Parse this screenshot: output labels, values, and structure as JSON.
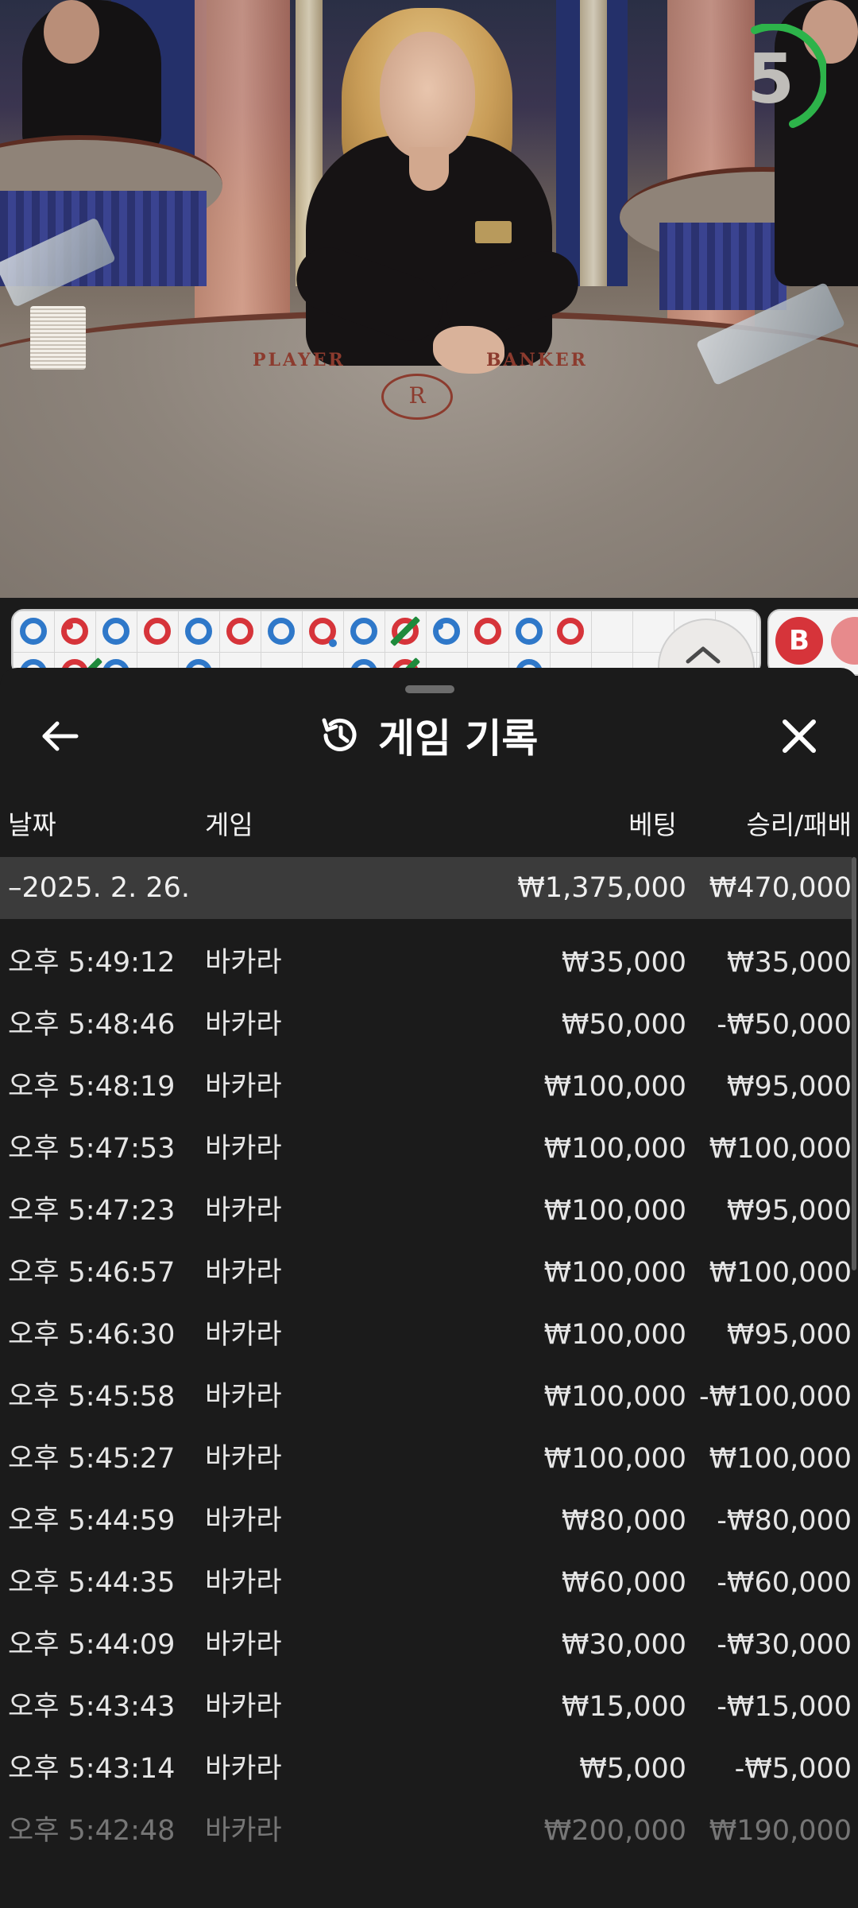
{
  "stream": {
    "countdown": "5",
    "felt_left": "PLAYER",
    "felt_right": "BANKER",
    "felt_logo": "R"
  },
  "roads": {
    "side_label": "B",
    "colors": {
      "player": "#2f78c9",
      "banker": "#d6343a",
      "tie": "#1f8a3c"
    }
  },
  "sheet": {
    "title": "게임 기록",
    "back_icon": "arrow-left-icon",
    "history_icon": "history-icon",
    "close_icon": "close-icon",
    "columns": {
      "date": "날짜",
      "game": "게임",
      "bet": "베팅",
      "win_loss": "승리/패배"
    },
    "summary": {
      "date": "–2025. 2. 26.",
      "bet": "₩1,375,000",
      "win_loss": "₩470,000"
    },
    "rows": [
      {
        "time": "오후 5:49:12",
        "game": "바카라",
        "bet": "₩35,000",
        "win_loss": "₩35,000"
      },
      {
        "time": "오후 5:48:46",
        "game": "바카라",
        "bet": "₩50,000",
        "win_loss": "-₩50,000"
      },
      {
        "time": "오후 5:48:19",
        "game": "바카라",
        "bet": "₩100,000",
        "win_loss": "₩95,000"
      },
      {
        "time": "오후 5:47:53",
        "game": "바카라",
        "bet": "₩100,000",
        "win_loss": "₩100,000"
      },
      {
        "time": "오후 5:47:23",
        "game": "바카라",
        "bet": "₩100,000",
        "win_loss": "₩95,000"
      },
      {
        "time": "오후 5:46:57",
        "game": "바카라",
        "bet": "₩100,000",
        "win_loss": "₩100,000"
      },
      {
        "time": "오후 5:46:30",
        "game": "바카라",
        "bet": "₩100,000",
        "win_loss": "₩95,000"
      },
      {
        "time": "오후 5:45:58",
        "game": "바카라",
        "bet": "₩100,000",
        "win_loss": "-₩100,000"
      },
      {
        "time": "오후 5:45:27",
        "game": "바카라",
        "bet": "₩100,000",
        "win_loss": "₩100,000"
      },
      {
        "time": "오후 5:44:59",
        "game": "바카라",
        "bet": "₩80,000",
        "win_loss": "-₩80,000"
      },
      {
        "time": "오후 5:44:35",
        "game": "바카라",
        "bet": "₩60,000",
        "win_loss": "-₩60,000"
      },
      {
        "time": "오후 5:44:09",
        "game": "바카라",
        "bet": "₩30,000",
        "win_loss": "-₩30,000"
      },
      {
        "time": "오후 5:43:43",
        "game": "바카라",
        "bet": "₩15,000",
        "win_loss": "-₩15,000"
      },
      {
        "time": "오후 5:43:14",
        "game": "바카라",
        "bet": "₩5,000",
        "win_loss": "-₩5,000"
      },
      {
        "time": "오후 5:42:48",
        "game": "바카라",
        "bet": "₩200,000",
        "win_loss": "₩190,000"
      }
    ]
  }
}
